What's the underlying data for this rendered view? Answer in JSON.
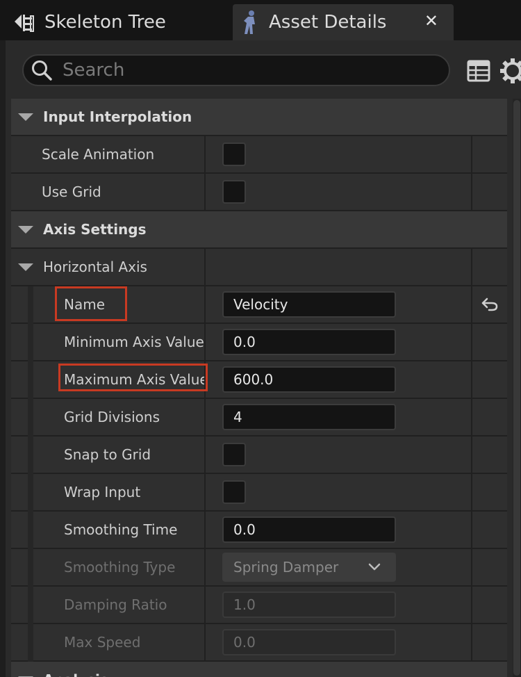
{
  "tabs": [
    {
      "label": "Skeleton Tree",
      "icon": "skeleton-tree-icon",
      "active": false
    },
    {
      "label": "Asset Details",
      "icon": "character-icon",
      "active": true,
      "close": "✕"
    }
  ],
  "search": {
    "placeholder": "Search",
    "value": ""
  },
  "toolbar": {
    "table_icon": "table-view-icon",
    "settings_icon": "gear-icon"
  },
  "sections": {
    "input_interpolation": {
      "label": "Input Interpolation",
      "scale_animation": {
        "label": "Scale Animation",
        "checked": false
      },
      "use_grid": {
        "label": "Use Grid",
        "checked": false
      }
    },
    "axis_settings": {
      "label": "Axis Settings",
      "horizontal_axis": {
        "label": "Horizontal Axis",
        "name": {
          "label": "Name",
          "value": "Velocity"
        },
        "min_axis_value": {
          "label": "Minimum Axis Value",
          "value": "0.0"
        },
        "max_axis_value": {
          "label": "Maximum Axis Value",
          "value": "600.0"
        },
        "grid_divisions": {
          "label": "Grid Divisions",
          "value": "4"
        },
        "snap_to_grid": {
          "label": "Snap to Grid",
          "checked": false
        },
        "wrap_input": {
          "label": "Wrap Input",
          "checked": false
        },
        "smoothing_time": {
          "label": "Smoothing Time",
          "value": "0.0"
        },
        "smoothing_type": {
          "label": "Smoothing Type",
          "value": "Spring Damper"
        },
        "damping_ratio": {
          "label": "Damping Ratio",
          "value": "1.0"
        },
        "max_speed": {
          "label": "Max Speed",
          "value": "0.0"
        }
      }
    },
    "analysis": {
      "label": "Analysis"
    }
  },
  "colors": {
    "highlight": "#c83a22",
    "panel": "#2f2f2f",
    "category": "#383838"
  }
}
